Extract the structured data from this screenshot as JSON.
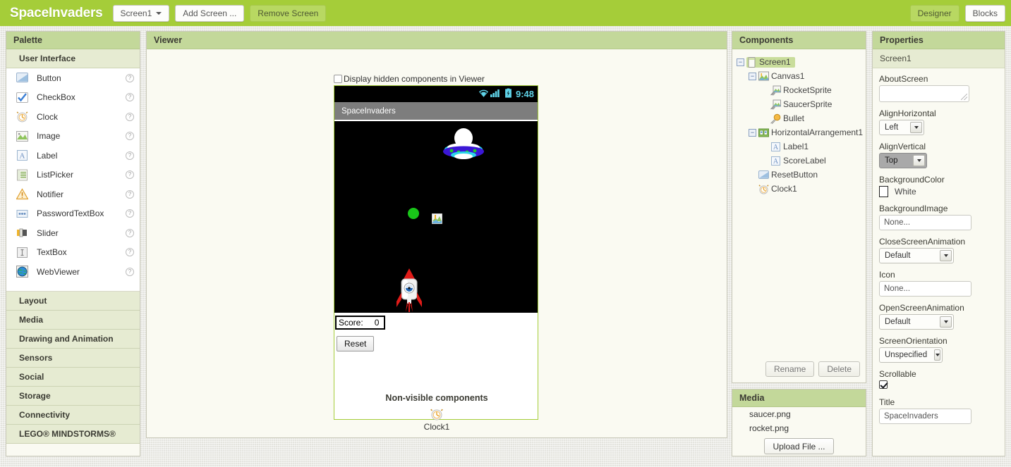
{
  "topbar": {
    "app_title": "SpaceInvaders",
    "screen_selector": "Screen1",
    "add_screen": "Add Screen ...",
    "remove_screen": "Remove Screen",
    "designer": "Designer",
    "blocks": "Blocks",
    "green": "#a5cd39"
  },
  "palette": {
    "header": "Palette",
    "open_category": "User Interface",
    "items": [
      {
        "label": "Button",
        "icon": "button-icon"
      },
      {
        "label": "CheckBox",
        "icon": "checkbox-icon"
      },
      {
        "label": "Clock",
        "icon": "clock-icon"
      },
      {
        "label": "Image",
        "icon": "image-icon"
      },
      {
        "label": "Label",
        "icon": "label-icon"
      },
      {
        "label": "ListPicker",
        "icon": "listpicker-icon"
      },
      {
        "label": "Notifier",
        "icon": "notifier-icon"
      },
      {
        "label": "PasswordTextBox",
        "icon": "passwordtextbox-icon"
      },
      {
        "label": "Slider",
        "icon": "slider-icon"
      },
      {
        "label": "TextBox",
        "icon": "textbox-icon"
      },
      {
        "label": "WebViewer",
        "icon": "webviewer-icon"
      }
    ],
    "categories": [
      "Layout",
      "Media",
      "Drawing and Animation",
      "Sensors",
      "Social",
      "Storage",
      "Connectivity",
      "LEGO® MINDSTORMS®"
    ],
    "help_glyph": "?"
  },
  "viewer": {
    "header": "Viewer",
    "hidden_components_label": "Display hidden components in Viewer",
    "hidden_components_checked": false,
    "phone": {
      "status_time": "9:48",
      "status_time_color": "#5fd3e8",
      "title": "SpaceInvaders",
      "canvas_background": "#000000",
      "sprites": [
        {
          "name": "SaucerSprite",
          "kind": "saucer"
        },
        {
          "name": "Bullet",
          "kind": "ball",
          "color": "#19c619"
        },
        {
          "name": "RocketSprite",
          "kind": "rocket"
        }
      ],
      "score_label_1": "Score:",
      "score_label_2": "0",
      "reset_button": "Reset"
    },
    "nonvisible": {
      "title": "Non-visible components",
      "items": [
        {
          "label": "Clock1",
          "icon": "clock-icon"
        }
      ]
    }
  },
  "components": {
    "header": "Components",
    "tree": [
      {
        "label": "Screen1",
        "depth": 0,
        "expander": "−",
        "icon": "screen-icon",
        "selected": true
      },
      {
        "label": "Canvas1",
        "depth": 1,
        "expander": "−",
        "icon": "canvas-icon",
        "selected": false
      },
      {
        "label": "RocketSprite",
        "depth": 2,
        "expander": "",
        "icon": "sprite-icon",
        "selected": false
      },
      {
        "label": "SaucerSprite",
        "depth": 2,
        "expander": "",
        "icon": "sprite-icon",
        "selected": false
      },
      {
        "label": "Bullet",
        "depth": 2,
        "expander": "",
        "icon": "ball-icon",
        "selected": false
      },
      {
        "label": "HorizontalArrangement1",
        "depth": 1,
        "expander": "−",
        "icon": "harrange-icon",
        "selected": false
      },
      {
        "label": "Label1",
        "depth": 2,
        "expander": "",
        "icon": "label-icon",
        "selected": false
      },
      {
        "label": "ScoreLabel",
        "depth": 2,
        "expander": "",
        "icon": "label-icon",
        "selected": false
      },
      {
        "label": "ResetButton",
        "depth": 1,
        "expander": "",
        "icon": "button-icon",
        "selected": false
      },
      {
        "label": "Clock1",
        "depth": 1,
        "expander": "",
        "icon": "clock-icon",
        "selected": false
      }
    ],
    "rename": "Rename",
    "delete": "Delete"
  },
  "media": {
    "header": "Media",
    "files": [
      "saucer.png",
      "rocket.png"
    ],
    "upload": "Upload File ..."
  },
  "properties": {
    "header": "Properties",
    "selected_component": "Screen1",
    "rows": [
      {
        "name": "AboutScreen",
        "type": "textarea",
        "value": ""
      },
      {
        "name": "AlignHorizontal",
        "type": "select",
        "value": "Left",
        "hover": false
      },
      {
        "name": "AlignVertical",
        "type": "select",
        "value": "Top",
        "hover": true
      },
      {
        "name": "BackgroundColor",
        "type": "color",
        "value": "White",
        "swatch": "#ffffff"
      },
      {
        "name": "BackgroundImage",
        "type": "text",
        "value": "None..."
      },
      {
        "name": "CloseScreenAnimation",
        "type": "select",
        "value": "Default",
        "hover": false
      },
      {
        "name": "Icon",
        "type": "text",
        "value": "None..."
      },
      {
        "name": "OpenScreenAnimation",
        "type": "select",
        "value": "Default",
        "hover": false
      },
      {
        "name": "ScreenOrientation",
        "type": "select",
        "value": "Unspecified",
        "hover": false
      },
      {
        "name": "Scrollable",
        "type": "checkbox",
        "checked": true
      },
      {
        "name": "Title",
        "type": "text",
        "value": "SpaceInvaders"
      }
    ]
  }
}
